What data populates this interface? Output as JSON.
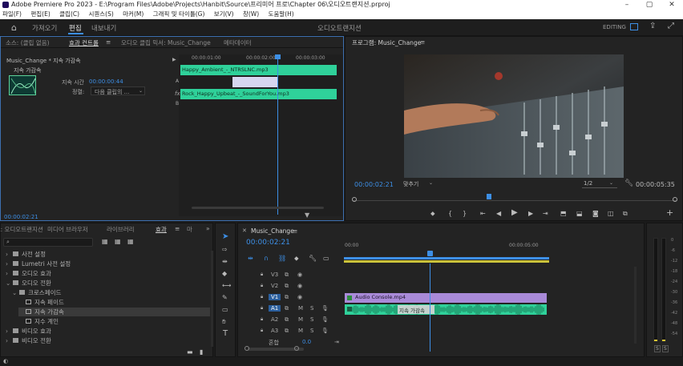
{
  "titlebar": {
    "title": "Adobe Premiere Pro 2023 - E:\\Program Files\\Adobe\\Projects\\Hanbit\\Source\\프리미어 프로\\Chapter 06\\오디오트랜지션.prproj",
    "minimize": "–",
    "maximize": "▢",
    "close": "✕"
  },
  "menu": [
    "파일(F)",
    "편집(E)",
    "클립(C)",
    "시퀀스(S)",
    "마커(M)",
    "그래픽 및 타이틀(G)",
    "보기(V)",
    "창(W)",
    "도움말(H)"
  ],
  "workspace": {
    "tabs": [
      "가져오기",
      "편집",
      "내보내기"
    ],
    "active": "편집",
    "center_title": "오디오트랜지션",
    "mode": "EDITING"
  },
  "source_panel": {
    "tabs": [
      "소스: (클립 없음)",
      "효과 컨트롤",
      "오디오 클립 믹서: Music_Change",
      "메타데이터"
    ],
    "active_tab": "효과 컨트롤",
    "breadcrumb": "Music_Change * 지속 가감속",
    "effect_name": "지속 가감속",
    "duration_label": "지속 시간",
    "duration_value": "00:00:00:44",
    "align_label": "정렬:",
    "align_value": "다음 클립의 ...",
    "ruler": [
      "00:00:01:00",
      "00:00:02:00",
      "00:00:03:00"
    ],
    "clip_a": "Happy_Ambient_-_NTRSLNC.mp3",
    "clip_b": "Rock_Happy_Upbeat_-_SoundForYou.mp3",
    "marker_a": "A",
    "marker_b": "B",
    "fx_label": "fx",
    "timecode": "00:00:02:21"
  },
  "program": {
    "tab": "프로그램: Music_Change",
    "timecode": "00:00:02:21",
    "fit": "맞추기",
    "resolution": "1/2",
    "duration": "00:00:05:35"
  },
  "project": {
    "tabs": [
      "프로젝트: 오디오트랜지션",
      "미디어 브라우저",
      "라이브러리",
      "효과",
      "마"
    ],
    "active_tab": "효과",
    "tree": [
      {
        "label": "사전 설정",
        "indent": 0,
        "expanded": false
      },
      {
        "label": "Lumetri 사전 설정",
        "indent": 0,
        "expanded": false
      },
      {
        "label": "오디오 효과",
        "indent": 0,
        "expanded": false
      },
      {
        "label": "오디오 전환",
        "indent": 0,
        "expanded": true
      },
      {
        "label": "크로스페이드",
        "indent": 1,
        "expanded": true
      },
      {
        "label": "지속 페이드",
        "indent": 2,
        "expanded": false
      },
      {
        "label": "지속 가감속",
        "indent": 2,
        "expanded": false,
        "selected": true
      },
      {
        "label": "지수 계인",
        "indent": 2,
        "expanded": false
      },
      {
        "label": "비디오 효과",
        "indent": 0,
        "expanded": false
      },
      {
        "label": "비디오 전환",
        "indent": 0,
        "expanded": false
      }
    ]
  },
  "timeline": {
    "tab": "Music_Change",
    "timecode": "00:00:02:21",
    "ruler": [
      "00:00",
      "00:00:05:00"
    ],
    "tracks": [
      {
        "id": "V3",
        "type": "video"
      },
      {
        "id": "V2",
        "type": "video"
      },
      {
        "id": "V1",
        "type": "video",
        "source": "V1"
      },
      {
        "id": "A1",
        "type": "audio",
        "source": "A1"
      },
      {
        "id": "A2",
        "type": "audio"
      },
      {
        "id": "A3",
        "type": "audio"
      }
    ],
    "video_clip": "Audio Console.mp4",
    "transition_label": "지속 가감속",
    "master_label": "혼합",
    "master_value": "0.0",
    "mute": "M",
    "solo": "S"
  },
  "meter": {
    "scale": [
      "0",
      "-6",
      "-12",
      "-18",
      "-24",
      "-30",
      "-36",
      "-42",
      "-48",
      "-54"
    ],
    "solo_left": "S",
    "solo_right": "S"
  },
  "colors": {
    "accent": "#3d8fe6",
    "audio_clip": "#2ecc8f",
    "video_clip": "#a98ad8",
    "playhead": "#3d8fe6"
  }
}
